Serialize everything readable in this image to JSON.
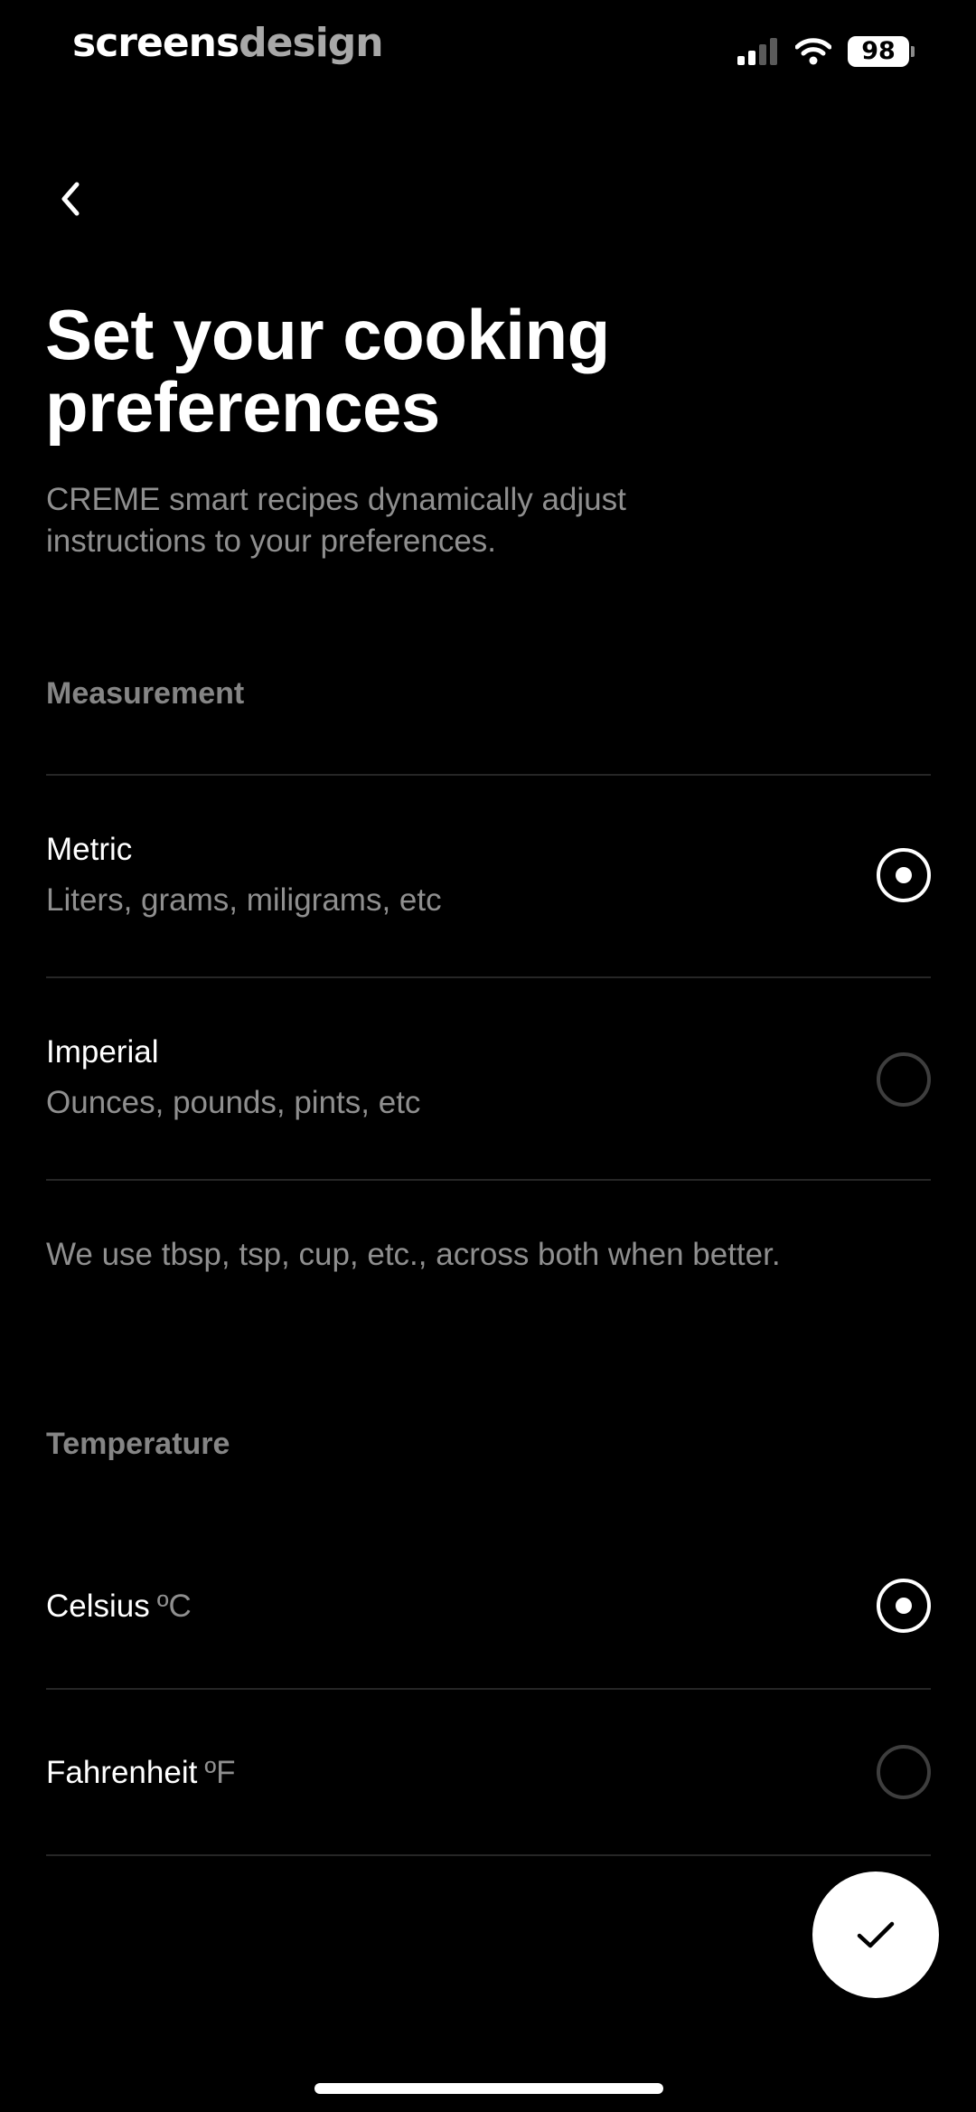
{
  "status_bar": {
    "brand_part1": "screens",
    "brand_part2": "design",
    "battery_level": "98",
    "cellular_icon": "cellular-signal-icon",
    "wifi_icon": "wifi-icon"
  },
  "header": {
    "back_icon": "chevron-left-icon",
    "title": "Set your cooking preferences",
    "subtitle": "CREME smart recipes dynamically adjust instructions to your preferences."
  },
  "measurement": {
    "label": "Measurement",
    "selected": "metric",
    "options": [
      {
        "id": "metric",
        "title": "Metric",
        "description": "Liters, grams, miligrams, etc",
        "selected": true
      },
      {
        "id": "imperial",
        "title": "Imperial",
        "description": "Ounces, pounds, pints, etc",
        "selected": false
      }
    ],
    "note": "We use tbsp, tsp, cup, etc., across both when better."
  },
  "temperature": {
    "label": "Temperature",
    "selected": "celsius",
    "options": [
      {
        "id": "celsius",
        "title": "Celsius",
        "unit": "ºC",
        "selected": true
      },
      {
        "id": "fahrenheit",
        "title": "Fahrenheit",
        "unit": "ºF",
        "selected": false
      }
    ]
  },
  "confirm": {
    "icon": "checkmark-icon"
  },
  "colors": {
    "background": "#000000",
    "text_primary": "#ffffff",
    "text_secondary": "#8f8f8f",
    "divider": "#262626",
    "radio_unselected": "#3e3e3e",
    "button_bg": "#ffffff"
  }
}
